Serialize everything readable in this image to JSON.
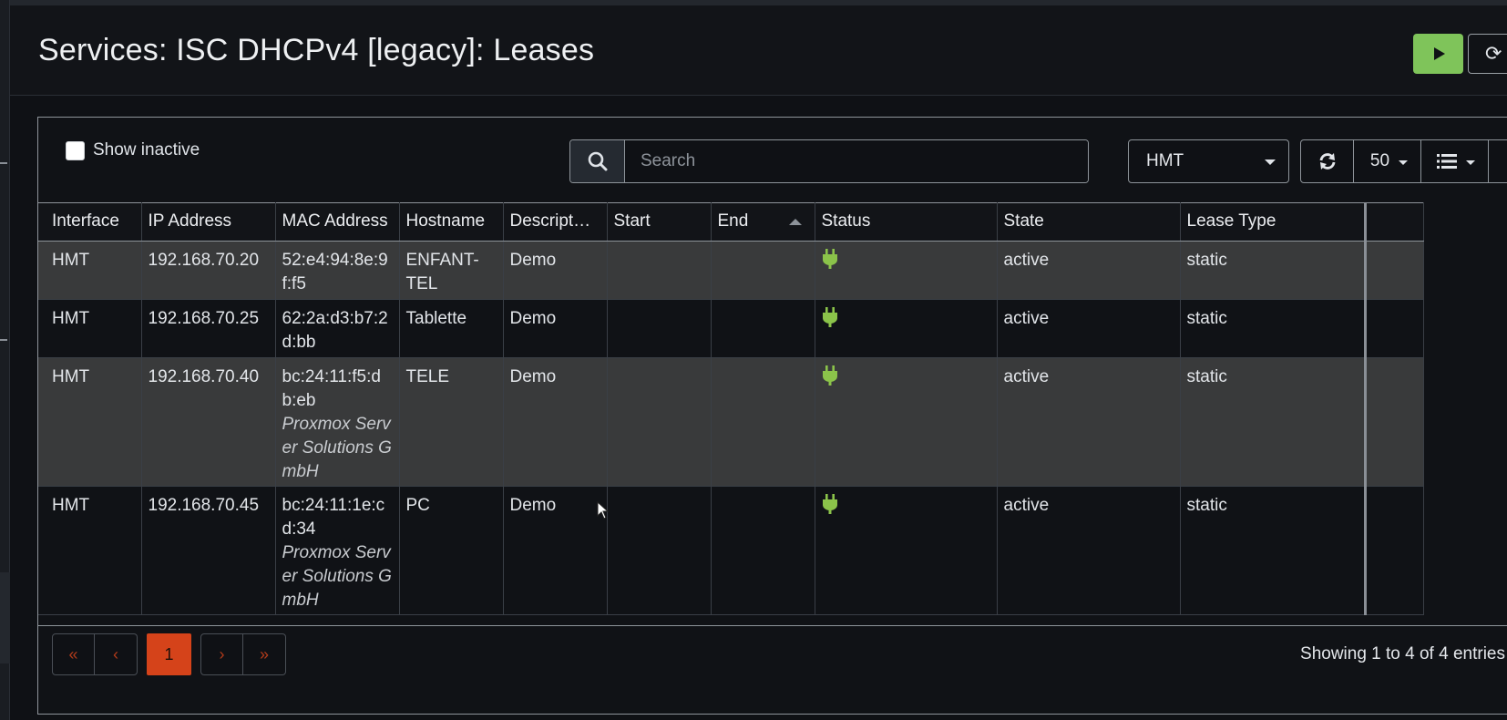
{
  "header": {
    "title": "Services: ISC DHCPv4 [legacy]: Leases"
  },
  "toolbar": {
    "show_inactive_label": "Show inactive",
    "search_placeholder": "Search",
    "interface_selected": "HMT",
    "row_count": "50"
  },
  "table": {
    "columns": [
      "Interface",
      "IP Address",
      "MAC Address",
      "Hostname",
      "Descript…",
      "Start",
      "End",
      "Status",
      "State",
      "Lease Type"
    ],
    "rows": [
      {
        "interface": "HMT",
        "ip": "192.168.70.20",
        "mac": "52:e4:94:8e:9f:f5",
        "vendor": "",
        "hostname": "ENFANT-TEL",
        "description": "Demo",
        "start": "",
        "end": "",
        "status_icon": "plug-icon",
        "state": "active",
        "lease_type": "static"
      },
      {
        "interface": "HMT",
        "ip": "192.168.70.25",
        "mac": "62:2a:d3:b7:2d:bb",
        "vendor": "",
        "hostname": "Tablette",
        "description": "Demo",
        "start": "",
        "end": "",
        "status_icon": "plug-icon",
        "state": "active",
        "lease_type": "static"
      },
      {
        "interface": "HMT",
        "ip": "192.168.70.40",
        "mac": "bc:24:11:f5:db:eb",
        "vendor": "Proxmox Server Solutions GmbH",
        "hostname": "TELE",
        "description": "Demo",
        "start": "",
        "end": "",
        "status_icon": "plug-icon",
        "state": "active",
        "lease_type": "static"
      },
      {
        "interface": "HMT",
        "ip": "192.168.70.45",
        "mac": "bc:24:11:1e:cd:34",
        "vendor": "Proxmox Server Solutions GmbH",
        "hostname": "PC",
        "description": "Demo",
        "start": "",
        "end": "",
        "status_icon": "plug-icon",
        "state": "active",
        "lease_type": "static"
      }
    ]
  },
  "pagination": {
    "first": "«",
    "prev": "‹",
    "current": "1",
    "next": "›",
    "last": "»",
    "info": "Showing 1 to 4 of 4 entries"
  },
  "colors": {
    "accent_green": "#7fc45a",
    "accent_orange": "#d5431a",
    "status_green": "#8bc34a"
  }
}
